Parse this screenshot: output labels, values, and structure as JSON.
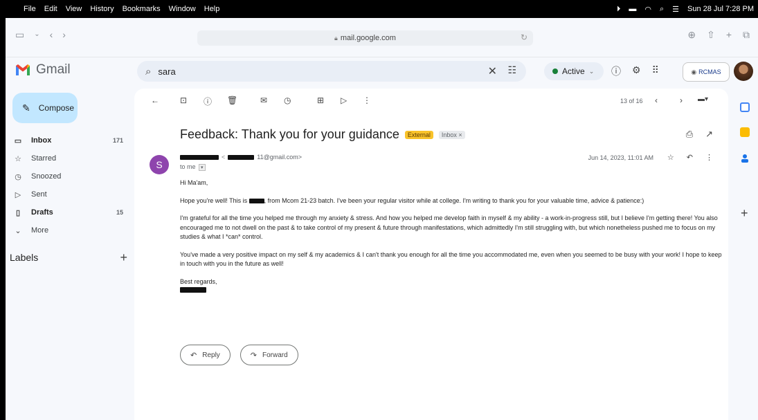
{
  "menubar": {
    "items": [
      "File",
      "Edit",
      "View",
      "History",
      "Bookmarks",
      "Window",
      "Help"
    ],
    "clock": "Sun 28 Jul 7:28 PM"
  },
  "browser": {
    "url": "mail.google.com"
  },
  "gmail": {
    "brand": "Gmail",
    "search_value": "sara",
    "status": "Active",
    "org_badge": "RCMAS"
  },
  "sidebar": {
    "compose_label": "Compose",
    "items": [
      {
        "label": "Inbox",
        "count": "171",
        "icon": "inbox-icon"
      },
      {
        "label": "Starred",
        "count": "",
        "icon": "star-icon"
      },
      {
        "label": "Snoozed",
        "count": "",
        "icon": "clock-icon"
      },
      {
        "label": "Sent",
        "count": "",
        "icon": "send-icon"
      },
      {
        "label": "Drafts",
        "count": "15",
        "icon": "draft-icon"
      },
      {
        "label": "More",
        "count": "",
        "icon": "chevron-down-icon"
      }
    ],
    "labels_heading": "Labels"
  },
  "email": {
    "pager": "13 of 16",
    "subject": "Feedback: Thank you for your guidance",
    "tag_external": "External",
    "tag_inbox": "Inbox ×",
    "sender_initial": "S",
    "sender_email_suffix": "11@gmail.com>",
    "to": "to me",
    "date": "Jun 14, 2023, 11:01 AM",
    "greeting": "Hi Ma'am,",
    "p1_a": "Hope you're well! This is",
    "p1_b": ", from Mcom 21-23 batch. I've been your regular visitor while at college. I'm writing to thank you  for your valuable time, advice & patience:)",
    "p2": "I'm grateful for all the time you helped me through my anxiety & stress. And how you helped me develop faith in myself & my ability - a work-in-progress still, but I believe I'm getting there! You also encouraged me to not dwell on the past & to take control of my present & future through manifestations, which admittedly I'm still struggling with, but which nonetheless pushed me to focus on my studies & what I *can* control.",
    "p3": "You've made a very positive impact on my self & my academics & I can't thank you enough for all the time you accommodated me, even when you seemed to be busy with your work! I hope to keep in touch with you in the future as well!",
    "signoff": "Best regards,",
    "reply_label": "Reply",
    "forward_label": "Forward"
  }
}
